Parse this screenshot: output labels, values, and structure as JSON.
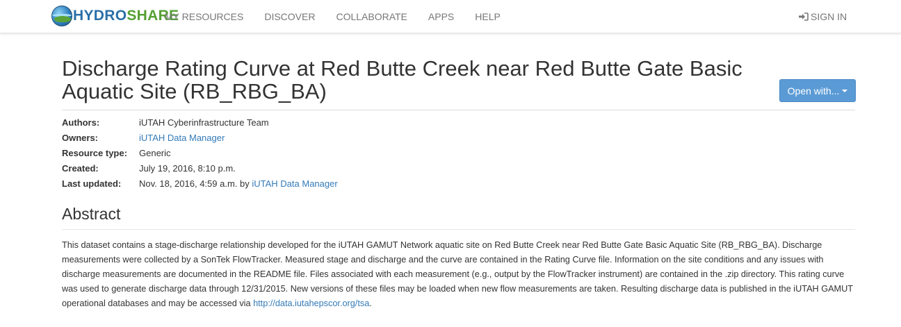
{
  "brand": {
    "part1": "HYDRO",
    "part2": "SHARE"
  },
  "nav": {
    "items": [
      {
        "label": "MY RESOURCES"
      },
      {
        "label": "DISCOVER"
      },
      {
        "label": "COLLABORATE"
      },
      {
        "label": "APPS"
      },
      {
        "label": "HELP"
      }
    ],
    "signin_label": "SIGN IN"
  },
  "resource": {
    "title": "Discharge Rating Curve at Red Butte Creek near Red Butte Gate Basic Aquatic Site (RB_RBG_BA)",
    "open_with_label": "Open with...",
    "meta": {
      "authors_label": "Authors:",
      "authors_value": "iUTAH Cyberinfrastructure Team",
      "owners_label": "Owners:",
      "owners_value": "iUTAH Data Manager",
      "type_label": "Resource type:",
      "type_value": "Generic",
      "created_label": "Created:",
      "created_value": "July 19, 2016, 8:10 p.m.",
      "updated_label": "Last updated:",
      "updated_value": "Nov. 18, 2016, 4:59 a.m. by",
      "updated_by": "iUTAH Data Manager"
    }
  },
  "abstract": {
    "heading": "Abstract",
    "text": "This dataset contains a stage-discharge relationship developed for the iUTAH GAMUT Network aquatic site on Red Butte Creek near Red Butte Gate Basic Aquatic Site (RB_RBG_BA). Discharge measurements were collected by a SonTek FlowTracker. Measured stage and discharge and the curve are contained in the Rating Curve file. Information on the site conditions and any issues with discharge measurements are documented in the README file. Files associated with each measurement (e.g., output by the FlowTracker instrument) are contained in the .zip directory. This rating curve was used to generate discharge data through 12/31/2015. New versions of these files may be loaded when new flow measurements are taken. Resulting discharge data is published in the iUTAH GAMUT operational databases and may be accessed via",
    "link": "http://data.iutahepscor.org/tsa",
    "end": "."
  },
  "colors": {
    "link": "#337ab7",
    "button": "#5b9bd5",
    "brand_blue": "#2a6fa8",
    "brand_green": "#55a033"
  }
}
